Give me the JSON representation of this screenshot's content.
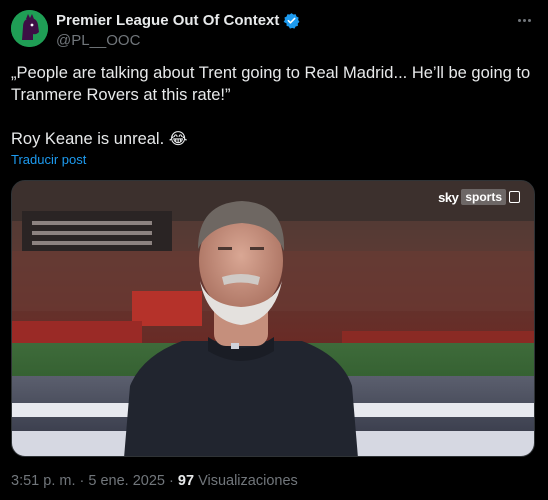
{
  "account": {
    "display_name": "Premier League Out Of Context",
    "handle": "@PL__OOC",
    "avatar_color": "#1f9e55",
    "verified_color": "#1d9bf0"
  },
  "tweet": {
    "line1": "„People are talking about Trent going to Real Madrid... He’ll be going to Tranmere Rovers at this rate!”",
    "line2": "Roy Keane is unreal.",
    "emoji": "😂",
    "translate_label": "Traducir post"
  },
  "media": {
    "broadcaster_word1": "sky",
    "broadcaster_word2": "sports"
  },
  "meta": {
    "time": "3:51 p. m.",
    "separator": "·",
    "date": "5 ene. 2025",
    "views_count": "97",
    "views_label": "Visualizaciones"
  },
  "colors": {
    "background": "#000000",
    "text": "#e7e9ea",
    "muted": "#71767b",
    "link": "#1d9bf0"
  }
}
